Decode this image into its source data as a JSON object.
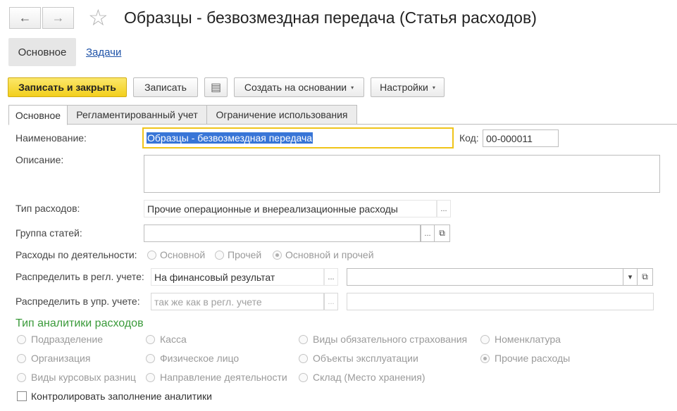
{
  "header": {
    "back_icon": "←",
    "forward_icon": "→",
    "star_icon": "☆",
    "title": "Образцы - безвозмездная передача (Статья расходов)"
  },
  "nav": {
    "main_tab": "Основное",
    "tasks_link": "Задачи"
  },
  "toolbar": {
    "save_close": "Записать и закрыть",
    "save": "Записать",
    "doc_icon": "▤",
    "create_based": "Создать на основании",
    "settings": "Настройки",
    "caret": "▾"
  },
  "tabs": [
    {
      "label": "Основное",
      "active": true
    },
    {
      "label": "Регламентированный учет",
      "active": false
    },
    {
      "label": "Ограничение использования",
      "active": false
    }
  ],
  "form": {
    "name_label": "Наименование:",
    "name_value": "Образцы - безвозмездная передача",
    "code_label": "Код:",
    "code_value": "00-000011",
    "description_label": "Описание:",
    "description_value": "",
    "expense_type_label": "Тип расходов:",
    "expense_type_value": "Прочие операционные и внереализационные расходы",
    "group_label": "Группа статей:",
    "group_value": "",
    "activity_label": "Расходы по деятельности:",
    "activity_options": [
      {
        "label": "Основной",
        "selected": false
      },
      {
        "label": "Прочей",
        "selected": false
      },
      {
        "label": "Основной и прочей",
        "selected": true
      }
    ],
    "dist_reg_label": "Распределить в регл. учете:",
    "dist_reg_value": "На финансовый результат",
    "dist_reg_second": "",
    "dist_mgmt_label": "Распределить в упр. учете:",
    "dist_mgmt_placeholder": "так же как в регл. учете",
    "dist_mgmt_second": "",
    "choose_icon": "...",
    "open_icon": "⧉",
    "dropdown_icon": "▾"
  },
  "analytics": {
    "section_title": "Тип аналитики расходов",
    "options": [
      {
        "label": "Подразделение",
        "selected": false
      },
      {
        "label": "Касса",
        "selected": false
      },
      {
        "label": "Виды обязательного страхования",
        "selected": false
      },
      {
        "label": "Номенклатура",
        "selected": false
      },
      {
        "label": "Организация",
        "selected": false
      },
      {
        "label": "Физическое лицо",
        "selected": false
      },
      {
        "label": "Объекты эксплуатации",
        "selected": false
      },
      {
        "label": "Прочие расходы",
        "selected": true
      },
      {
        "label": "Виды курсовых разниц",
        "selected": false
      },
      {
        "label": "Направление деятельности",
        "selected": false
      },
      {
        "label": "Склад (Место хранения)",
        "selected": false
      }
    ],
    "control_label": "Контролировать заполнение аналитики",
    "control_checked": false
  },
  "colors": {
    "primary_button": "#f2cf1c",
    "focus_border": "#f0c419",
    "section_title": "#3a9a3a",
    "link": "#1f53a8",
    "selection": "#3875d7"
  }
}
